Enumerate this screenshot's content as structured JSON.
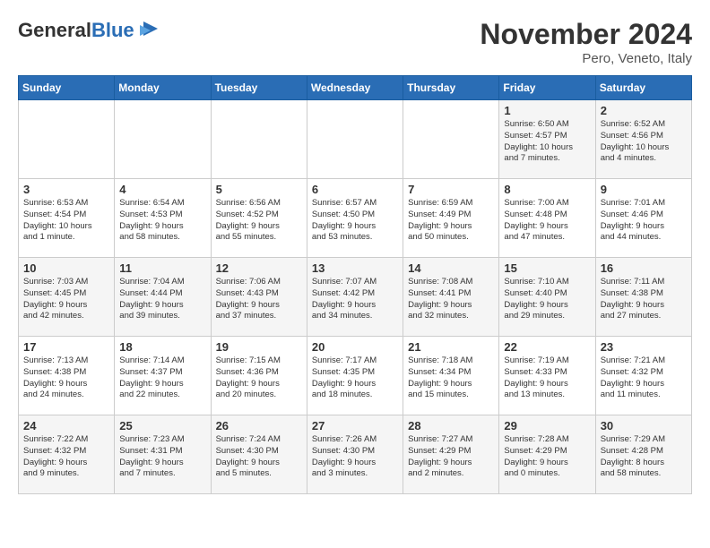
{
  "logo": {
    "general": "General",
    "blue": "Blue"
  },
  "header": {
    "month": "November 2024",
    "location": "Pero, Veneto, Italy"
  },
  "days_of_week": [
    "Sunday",
    "Monday",
    "Tuesday",
    "Wednesday",
    "Thursday",
    "Friday",
    "Saturday"
  ],
  "weeks": [
    [
      {
        "day": "",
        "info": ""
      },
      {
        "day": "",
        "info": ""
      },
      {
        "day": "",
        "info": ""
      },
      {
        "day": "",
        "info": ""
      },
      {
        "day": "",
        "info": ""
      },
      {
        "day": "1",
        "info": "Sunrise: 6:50 AM\nSunset: 4:57 PM\nDaylight: 10 hours\nand 7 minutes."
      },
      {
        "day": "2",
        "info": "Sunrise: 6:52 AM\nSunset: 4:56 PM\nDaylight: 10 hours\nand 4 minutes."
      }
    ],
    [
      {
        "day": "3",
        "info": "Sunrise: 6:53 AM\nSunset: 4:54 PM\nDaylight: 10 hours\nand 1 minute."
      },
      {
        "day": "4",
        "info": "Sunrise: 6:54 AM\nSunset: 4:53 PM\nDaylight: 9 hours\nand 58 minutes."
      },
      {
        "day": "5",
        "info": "Sunrise: 6:56 AM\nSunset: 4:52 PM\nDaylight: 9 hours\nand 55 minutes."
      },
      {
        "day": "6",
        "info": "Sunrise: 6:57 AM\nSunset: 4:50 PM\nDaylight: 9 hours\nand 53 minutes."
      },
      {
        "day": "7",
        "info": "Sunrise: 6:59 AM\nSunset: 4:49 PM\nDaylight: 9 hours\nand 50 minutes."
      },
      {
        "day": "8",
        "info": "Sunrise: 7:00 AM\nSunset: 4:48 PM\nDaylight: 9 hours\nand 47 minutes."
      },
      {
        "day": "9",
        "info": "Sunrise: 7:01 AM\nSunset: 4:46 PM\nDaylight: 9 hours\nand 44 minutes."
      }
    ],
    [
      {
        "day": "10",
        "info": "Sunrise: 7:03 AM\nSunset: 4:45 PM\nDaylight: 9 hours\nand 42 minutes."
      },
      {
        "day": "11",
        "info": "Sunrise: 7:04 AM\nSunset: 4:44 PM\nDaylight: 9 hours\nand 39 minutes."
      },
      {
        "day": "12",
        "info": "Sunrise: 7:06 AM\nSunset: 4:43 PM\nDaylight: 9 hours\nand 37 minutes."
      },
      {
        "day": "13",
        "info": "Sunrise: 7:07 AM\nSunset: 4:42 PM\nDaylight: 9 hours\nand 34 minutes."
      },
      {
        "day": "14",
        "info": "Sunrise: 7:08 AM\nSunset: 4:41 PM\nDaylight: 9 hours\nand 32 minutes."
      },
      {
        "day": "15",
        "info": "Sunrise: 7:10 AM\nSunset: 4:40 PM\nDaylight: 9 hours\nand 29 minutes."
      },
      {
        "day": "16",
        "info": "Sunrise: 7:11 AM\nSunset: 4:38 PM\nDaylight: 9 hours\nand 27 minutes."
      }
    ],
    [
      {
        "day": "17",
        "info": "Sunrise: 7:13 AM\nSunset: 4:38 PM\nDaylight: 9 hours\nand 24 minutes."
      },
      {
        "day": "18",
        "info": "Sunrise: 7:14 AM\nSunset: 4:37 PM\nDaylight: 9 hours\nand 22 minutes."
      },
      {
        "day": "19",
        "info": "Sunrise: 7:15 AM\nSunset: 4:36 PM\nDaylight: 9 hours\nand 20 minutes."
      },
      {
        "day": "20",
        "info": "Sunrise: 7:17 AM\nSunset: 4:35 PM\nDaylight: 9 hours\nand 18 minutes."
      },
      {
        "day": "21",
        "info": "Sunrise: 7:18 AM\nSunset: 4:34 PM\nDaylight: 9 hours\nand 15 minutes."
      },
      {
        "day": "22",
        "info": "Sunrise: 7:19 AM\nSunset: 4:33 PM\nDaylight: 9 hours\nand 13 minutes."
      },
      {
        "day": "23",
        "info": "Sunrise: 7:21 AM\nSunset: 4:32 PM\nDaylight: 9 hours\nand 11 minutes."
      }
    ],
    [
      {
        "day": "24",
        "info": "Sunrise: 7:22 AM\nSunset: 4:32 PM\nDaylight: 9 hours\nand 9 minutes."
      },
      {
        "day": "25",
        "info": "Sunrise: 7:23 AM\nSunset: 4:31 PM\nDaylight: 9 hours\nand 7 minutes."
      },
      {
        "day": "26",
        "info": "Sunrise: 7:24 AM\nSunset: 4:30 PM\nDaylight: 9 hours\nand 5 minutes."
      },
      {
        "day": "27",
        "info": "Sunrise: 7:26 AM\nSunset: 4:30 PM\nDaylight: 9 hours\nand 3 minutes."
      },
      {
        "day": "28",
        "info": "Sunrise: 7:27 AM\nSunset: 4:29 PM\nDaylight: 9 hours\nand 2 minutes."
      },
      {
        "day": "29",
        "info": "Sunrise: 7:28 AM\nSunset: 4:29 PM\nDaylight: 9 hours\nand 0 minutes."
      },
      {
        "day": "30",
        "info": "Sunrise: 7:29 AM\nSunset: 4:28 PM\nDaylight: 8 hours\nand 58 minutes."
      }
    ]
  ]
}
